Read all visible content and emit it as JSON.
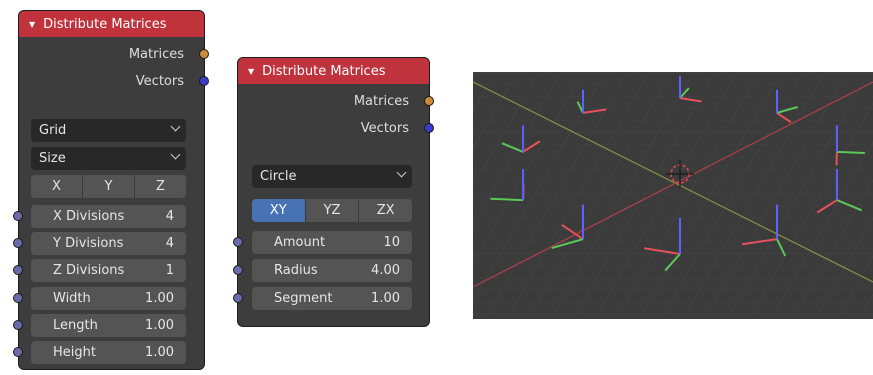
{
  "node1": {
    "title": "Distribute Matrices",
    "outputs": [
      "Matrices",
      "Vectors"
    ],
    "mode": "Grid",
    "dimension": "Size",
    "axes": [
      "X",
      "Y",
      "Z"
    ],
    "fields": [
      {
        "label": "X Divisions",
        "value": "4"
      },
      {
        "label": "Y Divisions",
        "value": "4"
      },
      {
        "label": "Z Divisions",
        "value": "1"
      },
      {
        "label": "Width",
        "value": "1.00"
      },
      {
        "label": "Length",
        "value": "1.00"
      },
      {
        "label": "Height",
        "value": "1.00"
      }
    ]
  },
  "node2": {
    "title": "Distribute Matrices",
    "outputs": [
      "Matrices",
      "Vectors"
    ],
    "mode": "Circle",
    "planes": [
      "XY",
      "YZ",
      "ZX"
    ],
    "active_plane": "XY",
    "fields": [
      {
        "label": "Amount",
        "value": "10"
      },
      {
        "label": "Radius",
        "value": "4.00"
      },
      {
        "label": "Segment",
        "value": "1.00"
      }
    ]
  },
  "colors": {
    "header": "#c0323c",
    "node_bg": "#3d3d3d",
    "field_bg": "#545454",
    "active": "#4772b3",
    "socket_matrix": "#cc8a3a",
    "socket_vector": "#3b3bc7",
    "axis_x": "#e8505a",
    "axis_y": "#5ac85a",
    "axis_z": "#6060ff"
  }
}
